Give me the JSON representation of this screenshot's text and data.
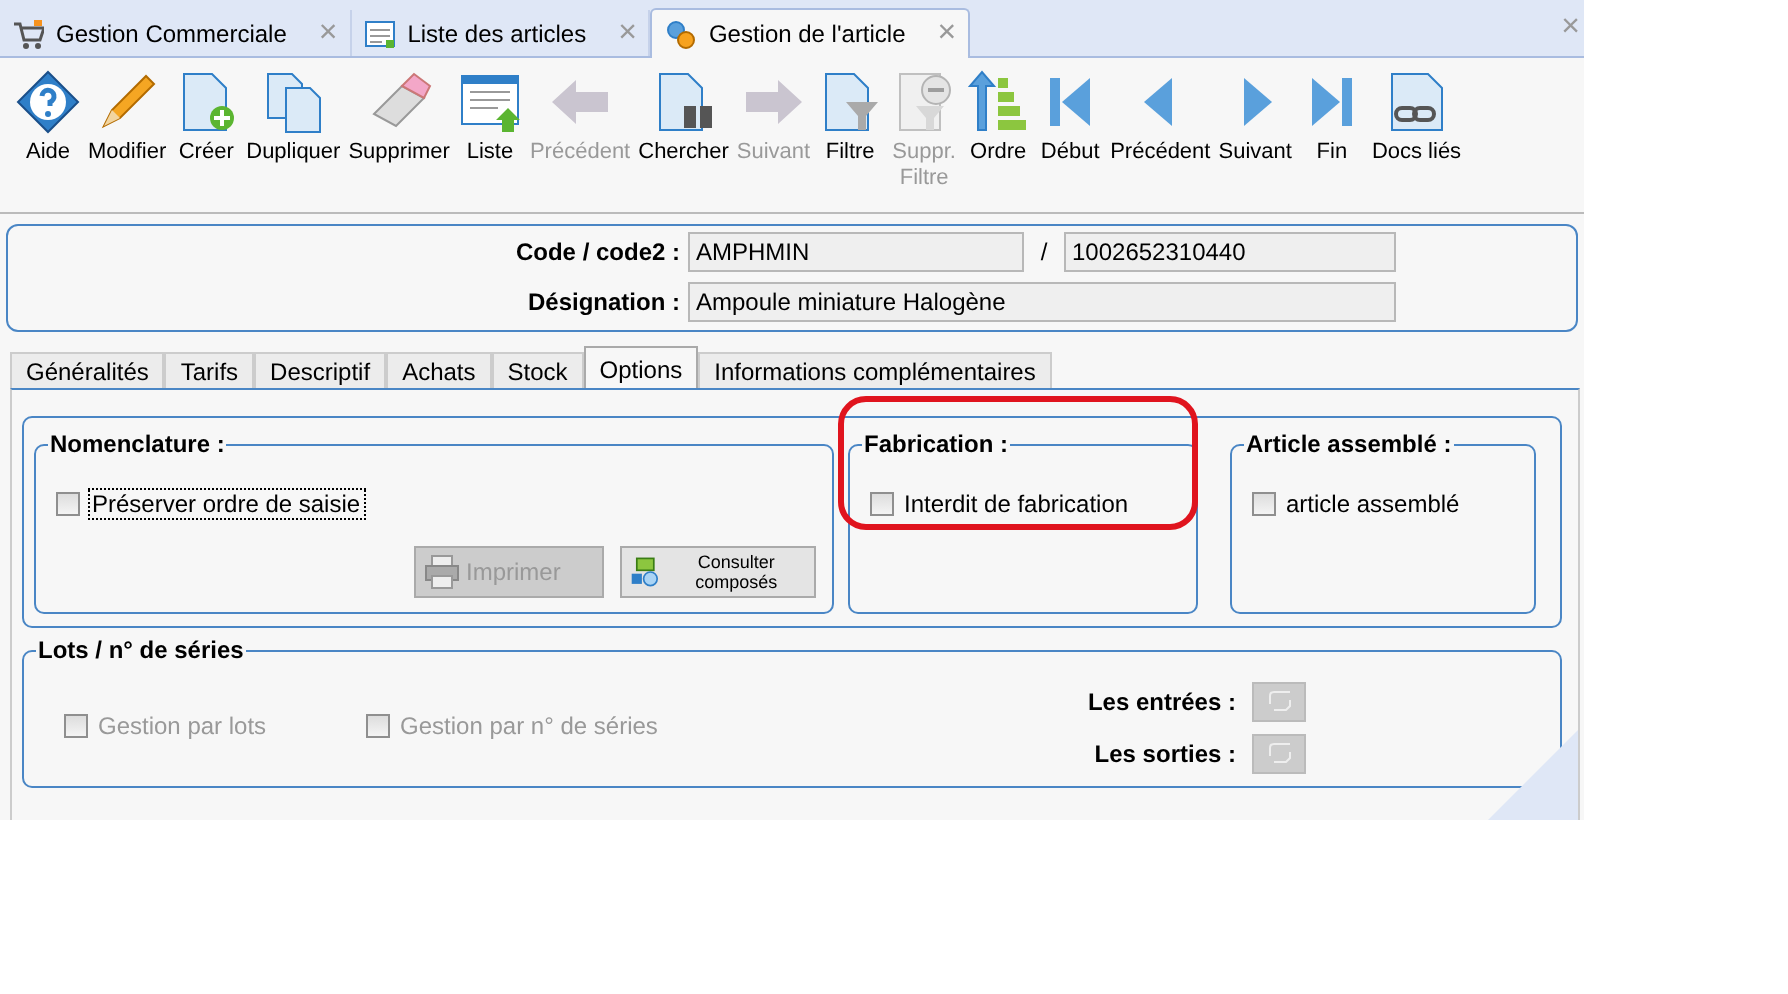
{
  "doc_tabs": [
    {
      "label": "Gestion Commerciale",
      "selected": false
    },
    {
      "label": "Liste des articles",
      "selected": false
    },
    {
      "label": "Gestion de l'article",
      "selected": true
    }
  ],
  "close_all": "×",
  "close_tab": "×",
  "toolbar": [
    {
      "label": "Aide",
      "disabled": false
    },
    {
      "label": "Modifier",
      "disabled": false
    },
    {
      "label": "Créer",
      "disabled": false
    },
    {
      "label": "Dupliquer",
      "disabled": false
    },
    {
      "label": "Supprimer",
      "disabled": false
    },
    {
      "label": "Liste",
      "disabled": false
    },
    {
      "label": "Précédent",
      "disabled": true
    },
    {
      "label": "Chercher",
      "disabled": false
    },
    {
      "label": "Suivant",
      "disabled": true
    },
    {
      "label": "Filtre",
      "disabled": false
    },
    {
      "label": "Suppr. Filtre",
      "disabled": true
    },
    {
      "label": "Ordre",
      "disabled": false
    },
    {
      "label": "Début",
      "disabled": false
    },
    {
      "label": "Précédent",
      "disabled": false
    },
    {
      "label": "Suivant",
      "disabled": false
    },
    {
      "label": "Fin",
      "disabled": false
    },
    {
      "label": "Docs liés",
      "disabled": false
    }
  ],
  "header": {
    "code_label": "Code / code2 :",
    "code": "AMPHMIN",
    "separator": "/",
    "code2": "1002652310440",
    "designation_label": "Désignation :",
    "designation": "Ampoule miniature Halogène"
  },
  "tabs": [
    {
      "label": "Généralités",
      "selected": false
    },
    {
      "label": "Tarifs",
      "selected": false
    },
    {
      "label": "Descriptif",
      "selected": false
    },
    {
      "label": "Achats",
      "selected": false
    },
    {
      "label": "Stock",
      "selected": false
    },
    {
      "label": "Options",
      "selected": true
    },
    {
      "label": "Informations complémentaires",
      "selected": false
    }
  ],
  "nomenclature": {
    "title": "Nomenclature :",
    "checkbox": {
      "label": "Préserver ordre de saisie",
      "checked": false,
      "focused": true
    },
    "print_button": {
      "label": "Imprimer",
      "disabled": true
    },
    "consult_button": {
      "label": "Consulter composés",
      "disabled": false
    }
  },
  "fabrication": {
    "title": "Fabrication :",
    "checkbox": {
      "label": "Interdit de fabrication",
      "checked": false
    }
  },
  "assembled": {
    "title": "Article assemblé :",
    "checkbox": {
      "label": "article assemblé",
      "checked": false
    }
  },
  "lots": {
    "title": "Lots / n° de séries",
    "checkboxes": [
      {
        "label": "Gestion par lots",
        "checked": false,
        "disabled": true
      },
      {
        "label": "Gestion par n° de séries",
        "checked": false,
        "disabled": true
      }
    ],
    "entries_label": "Les entrées :",
    "exits_label": "Les sorties :"
  }
}
